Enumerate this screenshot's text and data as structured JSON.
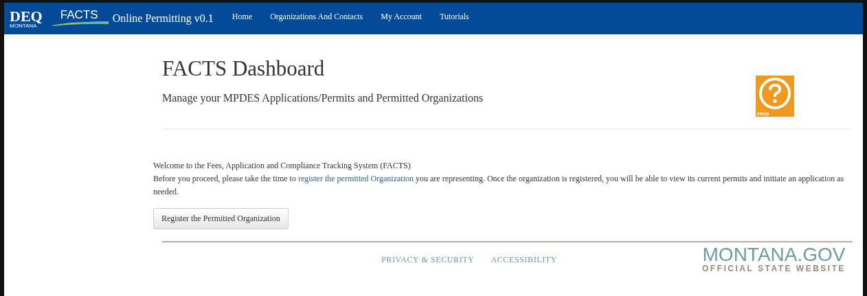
{
  "navbar": {
    "logo": {
      "main": "DEQ",
      "sub": "MONTANA"
    },
    "brand": "FACTS",
    "app_title": "Online Permitting v0.1",
    "links": [
      {
        "label": "Home"
      },
      {
        "label": "Organizations And Contacts"
      },
      {
        "label": "My Account"
      },
      {
        "label": "Tutorials"
      }
    ]
  },
  "header": {
    "title": "FACTS Dashboard",
    "subtitle": "Manage your MPDES Applications/Permits and Permitted Organizations",
    "help_label": "Help"
  },
  "welcome": {
    "line1": "Welcome to the Fees, Application and Compliance Tracking System (FACTS)",
    "before": "Before you proceed, please take the time to",
    "link": "register the permitted Organization",
    "after": "you are representing. Once the organization is registered, you will be able to view its current permits and initiate an application as needed."
  },
  "register_button": "Register the Permitted Organization",
  "footer": {
    "links": [
      "PRIVACY & SECURITY",
      "ACCESSIBILITY"
    ],
    "logo_main": "MONTANA.GOV",
    "logo_sub": "OFFICIAL STATE WEBSITE"
  }
}
